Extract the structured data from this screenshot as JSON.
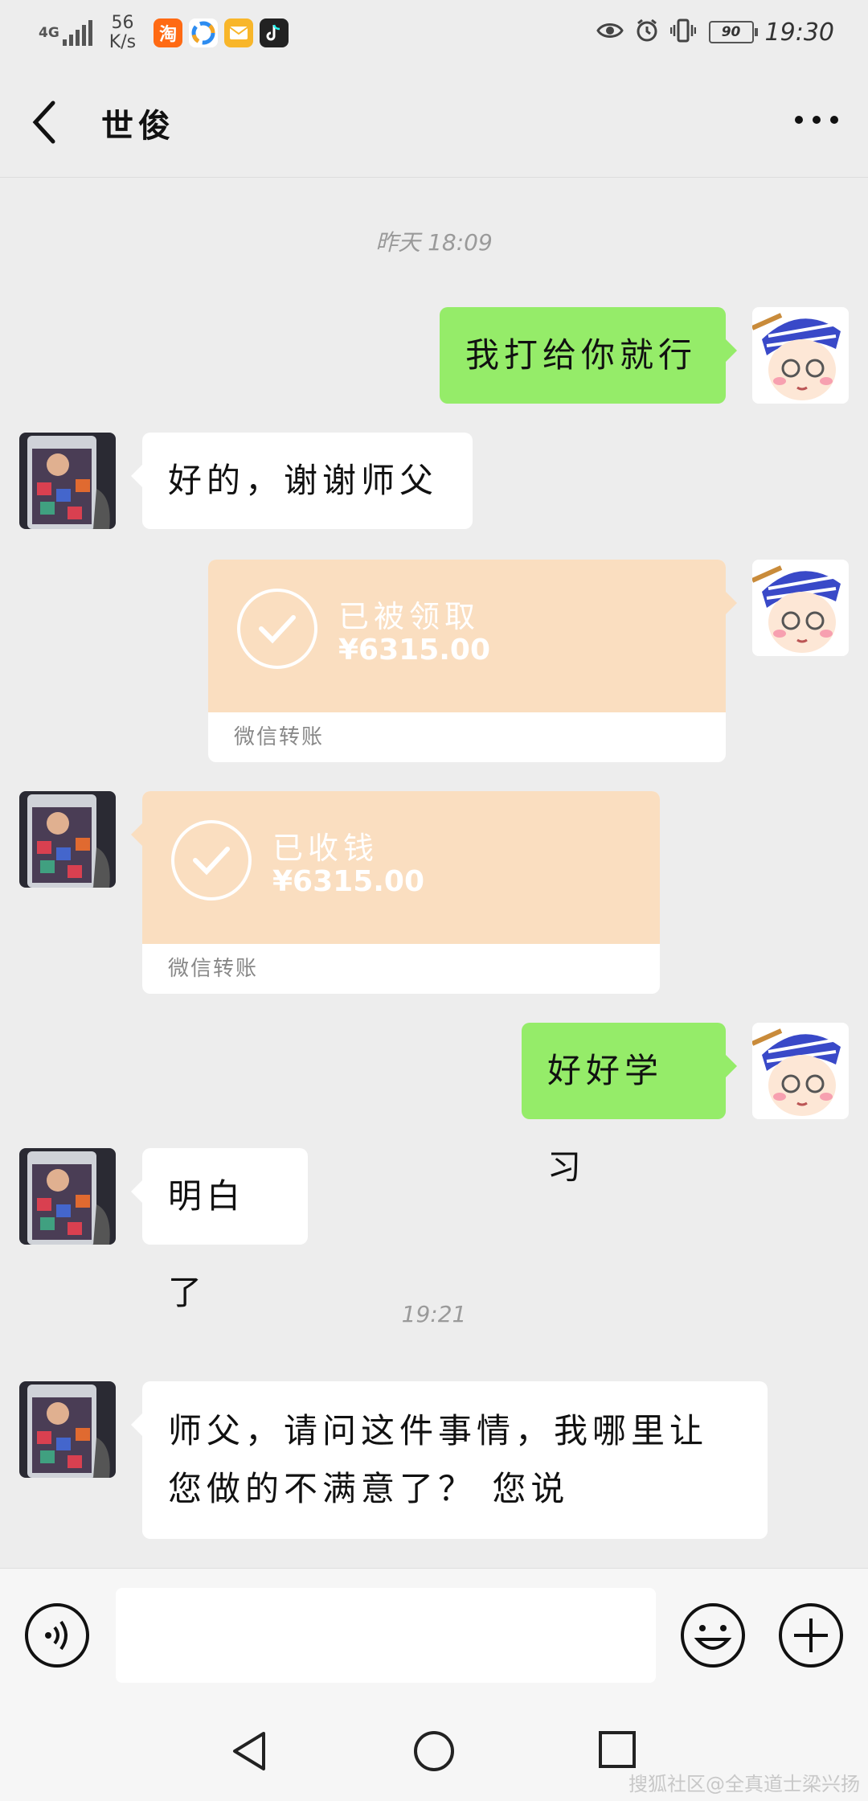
{
  "status_bar": {
    "network": "4G",
    "speed_value": "56",
    "speed_unit": "K/s",
    "taobao_glyph": "淘",
    "battery": "90",
    "time": "19:30",
    "icons": [
      "taobao-icon",
      "browser-icon",
      "mail-icon",
      "tiktok-icon",
      "eye-icon",
      "alarm-icon",
      "vibrate-icon"
    ]
  },
  "header": {
    "title": "世俊"
  },
  "chat": {
    "timestamp1": "昨天 18:09",
    "msg1": "我打给你就行",
    "msg2": "好的，谢谢师父",
    "transfer1": {
      "status": "已被领取",
      "amount": "¥6315.00",
      "label": "微信转账"
    },
    "transfer2": {
      "status": "已收钱",
      "amount": "¥6315.00",
      "label": "微信转账"
    },
    "msg3": "好好学习",
    "msg4": "明白了",
    "timestamp2": "19:21",
    "msg5_line1": "师父，请问这件事情，我哪里让",
    "msg5_line2": "您做的不满意了？ 您说"
  },
  "watermark": "搜狐社区@全真道士梁兴扬",
  "colors": {
    "sent_bubble": "#95ec69",
    "transfer_bg": "#fadec0",
    "background": "#ededed"
  }
}
